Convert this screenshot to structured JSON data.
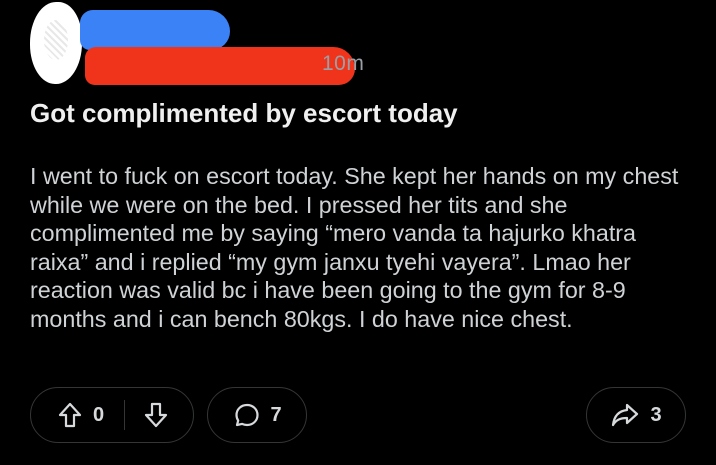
{
  "post": {
    "timestamp": "10m",
    "title": "Got complimented by escort today",
    "body": "I went to fuck on escort today. She kept her hands on my chest while we were on the bed. I pressed her tits and she complimented me by saying “mero vanda ta hajurko khatra raixa” and i replied “my gym janxu tyehi vayera”. Lmao her reaction was valid bc i have been going to the gym for 8-9 months and i can bench 80kgs. I do have nice chest."
  },
  "actions": {
    "upvote_icon": "upvote-arrow-icon",
    "vote_count": "0",
    "downvote_icon": "downvote-arrow-icon",
    "comment_icon": "comment-bubble-icon",
    "comment_count": "7",
    "share_icon": "share-arrow-icon",
    "share_count": "3"
  },
  "colors": {
    "background": "#000000",
    "text": "#d7dadc",
    "border": "#343536",
    "redaction_blue": "#3b82f6",
    "redaction_red": "#f0341b"
  }
}
